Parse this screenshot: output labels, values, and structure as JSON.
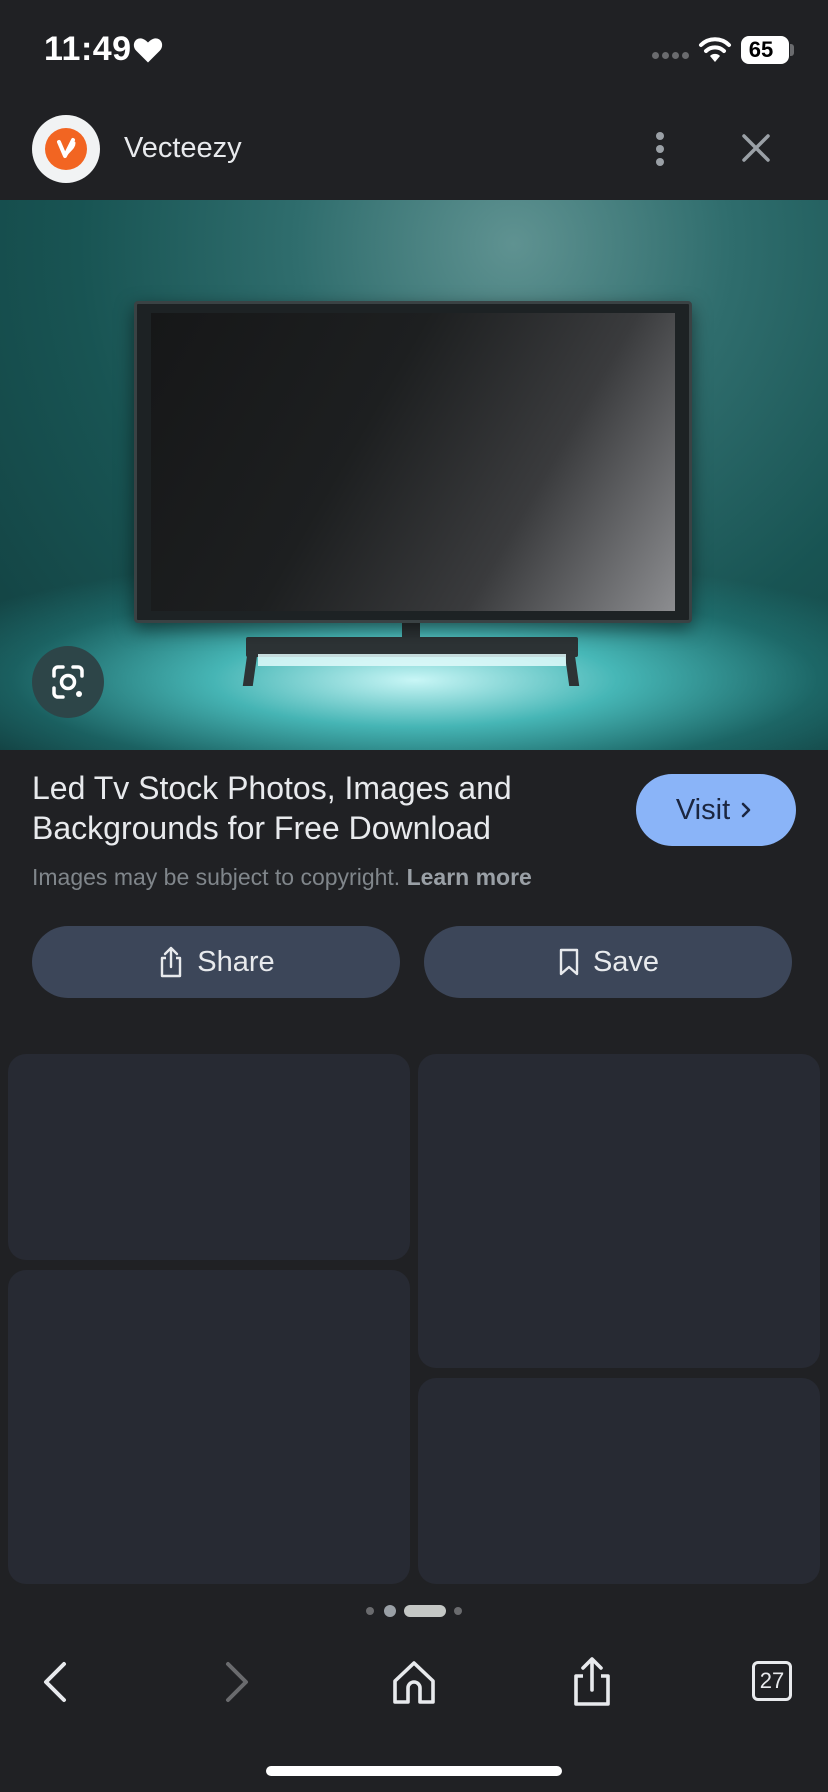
{
  "status_bar": {
    "time": "11:49",
    "battery": "65",
    "icons": [
      "heart-icon",
      "signal-icon",
      "wifi-icon",
      "battery-icon"
    ]
  },
  "header": {
    "site_name": "Vecteezy",
    "logo_icon": "vecteezy-logo",
    "more_icon": "more-vertical-icon",
    "close_icon": "close-icon"
  },
  "image": {
    "alt": "LED TV on teal background",
    "lens_icon": "google-lens-icon"
  },
  "result": {
    "title": "Led Tv Stock Photos, Images and Backgrounds for Free Download",
    "visit_label": "Visit",
    "copyright_text": "Images may be subject to copyright.",
    "learn_more": "Learn more"
  },
  "actions": {
    "share_label": "Share",
    "save_label": "Save"
  },
  "pager": {
    "active_index": 2,
    "count": 4
  },
  "toolbar": {
    "tab_count": "27",
    "icons": [
      "back-icon",
      "forward-icon",
      "home-icon",
      "share-icon",
      "tabs-icon"
    ]
  },
  "colors": {
    "background": "#202124",
    "accent": "#8ab4f8",
    "button": "#3c4659",
    "logo": "#f26522"
  }
}
